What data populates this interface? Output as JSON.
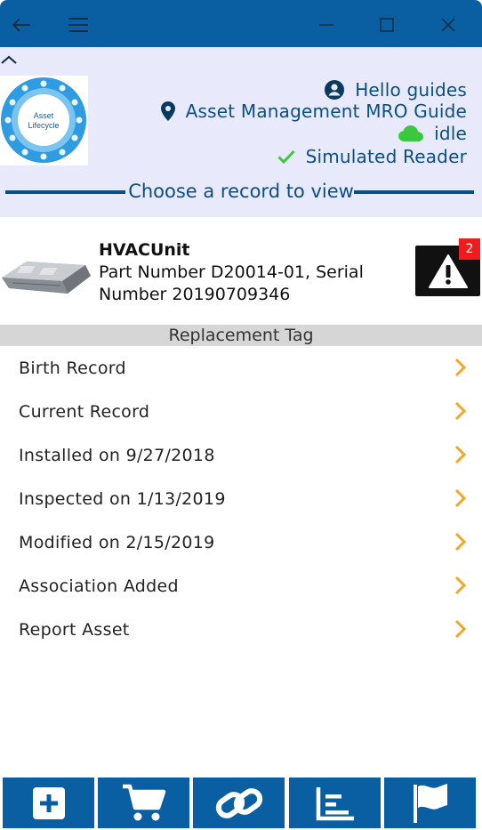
{
  "user": {
    "greeting": "Hello guides"
  },
  "location": {
    "name": "Asset Management MRO Guide"
  },
  "status": {
    "text": "idle",
    "color": "#3cc83c"
  },
  "reader": {
    "text": "Simulated Reader"
  },
  "logo": {
    "line1": "Asset",
    "line2": "Lifecycle"
  },
  "section": {
    "title": "Choose a record to view"
  },
  "asset": {
    "name": "HVACUnit",
    "detail": "Part Number D20014-01, Serial Number 20190709346",
    "alert_count": "2"
  },
  "tag": {
    "label": "Replacement Tag"
  },
  "records": [
    {
      "label": "Birth Record"
    },
    {
      "label": "Current Record"
    },
    {
      "label": "Installed on 9/27/2018"
    },
    {
      "label": "Inspected on 1/13/2019"
    },
    {
      "label": "Modified on 2/15/2019"
    },
    {
      "label": "Association Added"
    },
    {
      "label": "Report Asset"
    }
  ],
  "toolbar": {
    "icons": [
      "plus-square-icon",
      "cart-icon",
      "link-icon",
      "bar-chart-icon",
      "flag-icon"
    ]
  },
  "colors": {
    "brand": "#0a5fa3",
    "header_bg": "#e8eafb",
    "accent": "#f5a623",
    "badge": "#ee1c1c"
  }
}
